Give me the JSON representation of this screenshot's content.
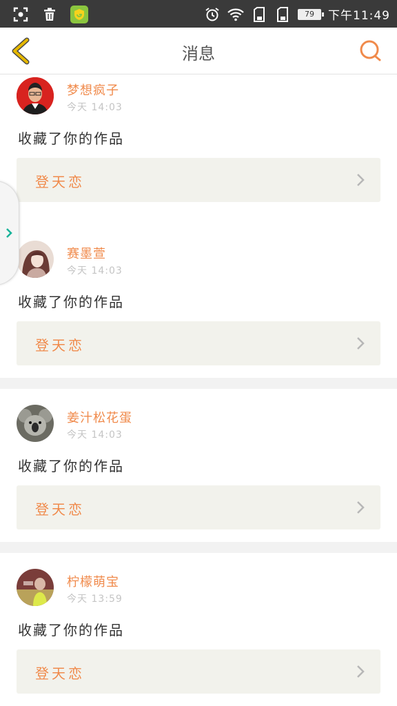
{
  "status_bar": {
    "battery_level": "79",
    "time": "下午11:49",
    "icons": [
      "screenshot-icon",
      "trash-icon",
      "app-shield-icon",
      "alarm-icon",
      "wifi-icon",
      "sim1-icon",
      "sim2-icon",
      "battery-icon"
    ]
  },
  "header": {
    "title": "消息",
    "back_icon": "chevron-left-icon",
    "search_icon": "search-icon"
  },
  "colors": {
    "accent": "#f08a4b",
    "header_back": "#e6b800",
    "side_arrow": "#18b39a"
  },
  "notifications": [
    {
      "user": "梦想疯子",
      "time": "今天 14:03",
      "action": "收藏了你的作品",
      "work": "登天恋",
      "avatar": "avatar-man-icon"
    },
    {
      "user": "赛墨萱",
      "time": "今天 14:03",
      "action": "收藏了你的作品",
      "work": "登天恋",
      "avatar": "avatar-girl-icon"
    },
    {
      "user": "姜汁松花蛋",
      "time": "今天 14:03",
      "action": "收藏了你的作品",
      "work": "登天恋",
      "avatar": "avatar-koala-icon"
    },
    {
      "user": "柠檬萌宝",
      "time": "今天 13:59",
      "action": "收藏了你的作品",
      "work": "登天恋",
      "avatar": "avatar-photo-icon"
    }
  ]
}
